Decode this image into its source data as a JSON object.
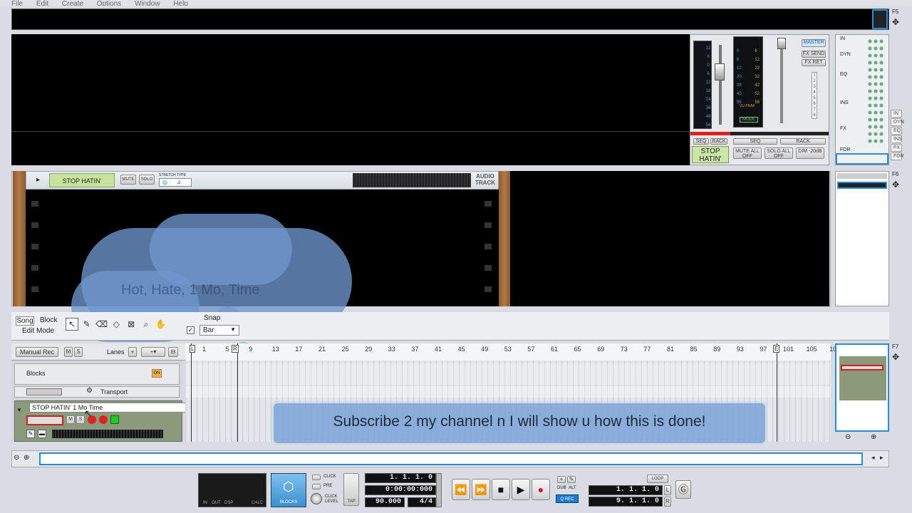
{
  "menu": [
    "File",
    "Edit",
    "Create",
    "Options",
    "Window",
    "Help"
  ],
  "right_panel": {
    "f5": "F5",
    "f6": "F6",
    "f7": "F7",
    "strip_labels": [
      "IN",
      "DYN",
      "EQ",
      "INS",
      "FX",
      "FDR"
    ],
    "side_tabs": [
      "IN",
      "DYN",
      "EQ",
      "INS",
      "FX",
      "FDR"
    ]
  },
  "mixer": {
    "master": "MASTER",
    "fx_send": "FX SEND",
    "fx_ret": "FX RET",
    "mode": "MODE",
    "vu_peak": "VU PEAK",
    "seq": "SEQ",
    "rack": "RACK",
    "channel_name": "STOP HATIN'",
    "mute_all": "MUTE ALL OFF",
    "solo_all": "SOLO ALL OFF",
    "dim": "DIM -20dB",
    "meter_scale": [
      "12",
      "6",
      "0",
      "6",
      "12",
      "18",
      "24",
      "36",
      "48",
      "56"
    ],
    "numbers": [
      "1",
      "2",
      "3",
      "4",
      "5",
      "6",
      "7",
      "8"
    ]
  },
  "rack": {
    "track_name": "STOP HATIN'",
    "mute": "MUTE",
    "solo": "SOLO",
    "stretch_type": "STRETCH TYPE",
    "device_label": "AUDIO TRACK"
  },
  "cloud_text": "Hot, Hate, 1 Mo, Time",
  "toolbar": {
    "song": "Song",
    "block": "Block",
    "edit_mode": "Edit Mode",
    "snap_label": "Snap",
    "snap_value": "Bar"
  },
  "seq_header": {
    "manual_rec": "Manual Rec",
    "m": "M",
    "s": "S",
    "lanes": "Lanes",
    "ruler": [
      "1",
      "5",
      "9",
      "13",
      "17",
      "21",
      "25",
      "29",
      "33",
      "37",
      "41",
      "45",
      "49",
      "53",
      "57",
      "61",
      "65",
      "69",
      "73",
      "77",
      "81",
      "85",
      "89",
      "93",
      "97",
      "101",
      "105",
      "10"
    ],
    "loop_l": "L",
    "loop_r": "R",
    "end": "E"
  },
  "tracks": {
    "blocks": "Blocks",
    "blocks_on": "ON",
    "transport": "Transport",
    "audio_track": "STOP HATIN' 1 Mo Time",
    "m": "M",
    "s": "S"
  },
  "subscribe_banner": "Subscribe 2 my channel n I will show u how this is done!",
  "transport": {
    "in_label": "IN",
    "out_label": "OUT",
    "dsp_label": "DSP",
    "calc": "CALC",
    "blocks": "BLOCKS",
    "click": "CLICK",
    "pre": "PRE",
    "click_level": "CLICK LEVEL",
    "tap": "TAP",
    "position": "1. 1. 1. 0",
    "time": "0:00:00:000",
    "tempo": "90.000",
    "signature": "4/4",
    "dub": "DUB",
    "alt": "ALT",
    "q_rec": "Q REC",
    "loop": "LOOP",
    "loop_left": "1. 1. 1. 0",
    "loop_right": "9. 1. 1. 0",
    "l": "L",
    "r": "R"
  }
}
